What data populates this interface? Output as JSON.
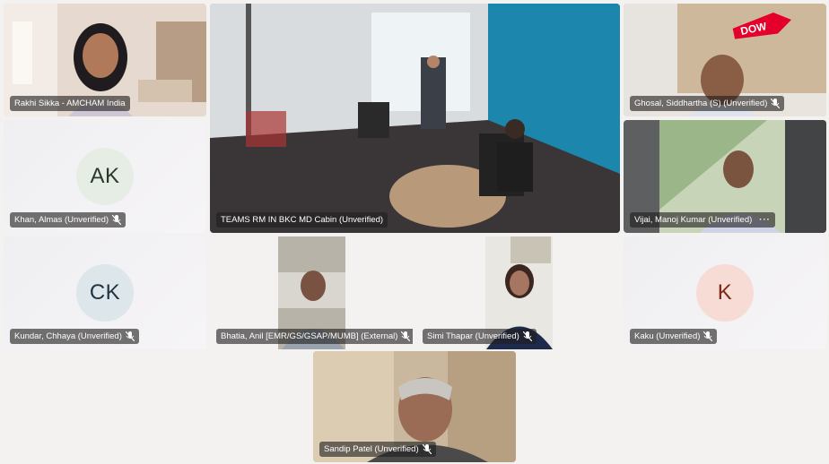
{
  "participants": [
    {
      "name": "Rakhi Sikka - AMCHAM India",
      "muted": false
    },
    {
      "name": "TEAMS RM IN BKC MD Cabin (Unverified)",
      "muted": false
    },
    {
      "name": "Ghosal, Siddhartha (S) (Unverified)",
      "muted": true
    },
    {
      "name": "Khan, Almas (Unverified)",
      "muted": true,
      "initials": "AK",
      "avatar_bg": "#e6ede4",
      "avatar_fg": "#2a3a2a"
    },
    {
      "name": "Vijai, Manoj Kumar (Unverified)",
      "muted": false,
      "more": "···"
    },
    {
      "name": "Kundar, Chhaya (Unverified)",
      "muted": true,
      "initials": "CK",
      "avatar_bg": "#dde6ea",
      "avatar_fg": "#1f3340"
    },
    {
      "name": "Bhatia, Anil [EMR/GS/GSAP/MUMB] (External)",
      "muted": true
    },
    {
      "name": "Simi Thapar (Unverified)",
      "muted": true
    },
    {
      "name": "Kaku (Unverified)",
      "muted": true,
      "initials": "K",
      "avatar_bg": "#f6dcd4",
      "avatar_fg": "#7a2a16"
    },
    {
      "name": "Sandip Patel (Unverified)",
      "muted": true
    }
  ],
  "logo": {
    "text": "DOW",
    "color": "#e4002b"
  },
  "icons": {
    "mic_off": "mic-off-icon"
  }
}
